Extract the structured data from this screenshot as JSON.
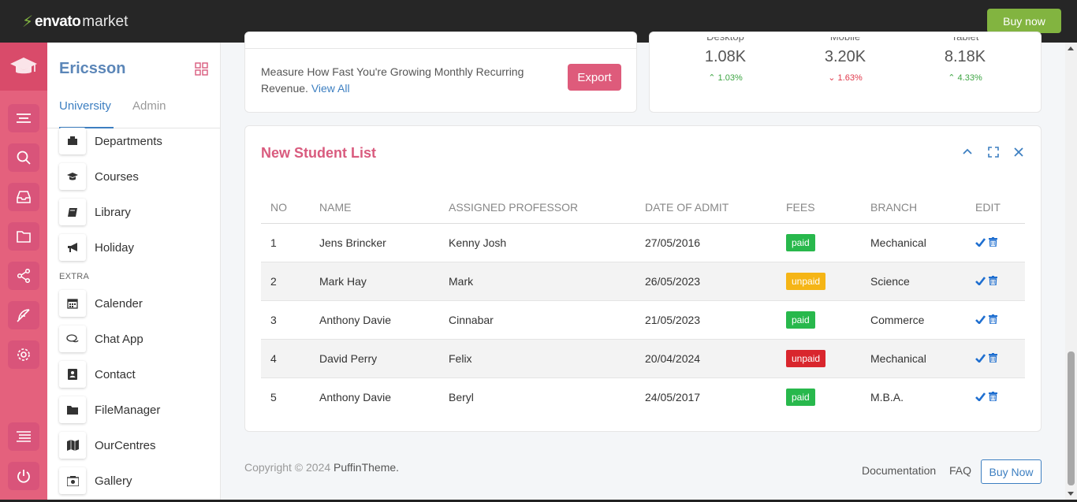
{
  "envato": {
    "brand": "envato",
    "market": "market",
    "buy_now": "Buy now"
  },
  "sidebar": {
    "title": "Ericsson",
    "tabs": [
      "University",
      "Admin"
    ],
    "items_top": [
      {
        "label": "Departments",
        "icon": "department-icon"
      },
      {
        "label": "Courses",
        "icon": "graduation-cap-icon"
      },
      {
        "label": "Library",
        "icon": "book-icon"
      },
      {
        "label": "Holiday",
        "icon": "megaphone-icon"
      }
    ],
    "section_extra": "EXTRA",
    "items_extra": [
      {
        "label": "Calender",
        "icon": "calendar-icon"
      },
      {
        "label": "Chat App",
        "icon": "chat-icon"
      },
      {
        "label": "Contact",
        "icon": "contact-icon"
      },
      {
        "label": "FileManager",
        "icon": "folder-icon"
      },
      {
        "label": "OurCentres",
        "icon": "map-icon"
      },
      {
        "label": "Gallery",
        "icon": "camera-icon"
      }
    ]
  },
  "revenue": {
    "text": "Measure How Fast You're Growing Monthly Recurring Revenue.",
    "link": "View All",
    "export": "Export"
  },
  "stats": [
    {
      "label": "Desktop",
      "value": "1.08K",
      "change": "1.03%",
      "direction": "up"
    },
    {
      "label": "Mobile",
      "value": "3.20K",
      "change": "1.63%",
      "direction": "down"
    },
    {
      "label": "Tablet",
      "value": "8.18K",
      "change": "4.33%",
      "direction": "up"
    }
  ],
  "students": {
    "title": "New Student List",
    "headers": [
      "NO",
      "NAME",
      "ASSIGNED PROFESSOR",
      "DATE OF ADMIT",
      "FEES",
      "BRANCH",
      "EDIT"
    ],
    "rows": [
      {
        "no": "1",
        "name": "Jens Brincker",
        "professor": "Kenny Josh",
        "date": "27/05/2016",
        "fees": "paid",
        "fees_status": "paid",
        "branch": "Mechanical"
      },
      {
        "no": "2",
        "name": "Mark Hay",
        "professor": "Mark",
        "date": "26/05/2023",
        "fees": "unpaid",
        "fees_status": "warning",
        "branch": "Science"
      },
      {
        "no": "3",
        "name": "Anthony Davie",
        "professor": "Cinnabar",
        "date": "21/05/2023",
        "fees": "paid",
        "fees_status": "paid",
        "branch": "Commerce"
      },
      {
        "no": "4",
        "name": "David Perry",
        "professor": "Felix",
        "date": "20/04/2024",
        "fees": "unpaid",
        "fees_status": "danger",
        "branch": "Mechanical"
      },
      {
        "no": "5",
        "name": "Anthony Davie",
        "professor": "Beryl",
        "date": "24/05/2017",
        "fees": "paid",
        "fees_status": "paid",
        "branch": "M.B.A."
      }
    ]
  },
  "footer": {
    "copyright": "Copyright © 2024",
    "brand": "PuffinTheme.",
    "links": [
      "Documentation",
      "FAQ"
    ],
    "buy_now": "Buy Now"
  },
  "colors": {
    "rail": "#e4617d",
    "accent_pink": "#d95b7e",
    "accent_blue": "#3d7fc1",
    "envato_green": "#82b440"
  }
}
